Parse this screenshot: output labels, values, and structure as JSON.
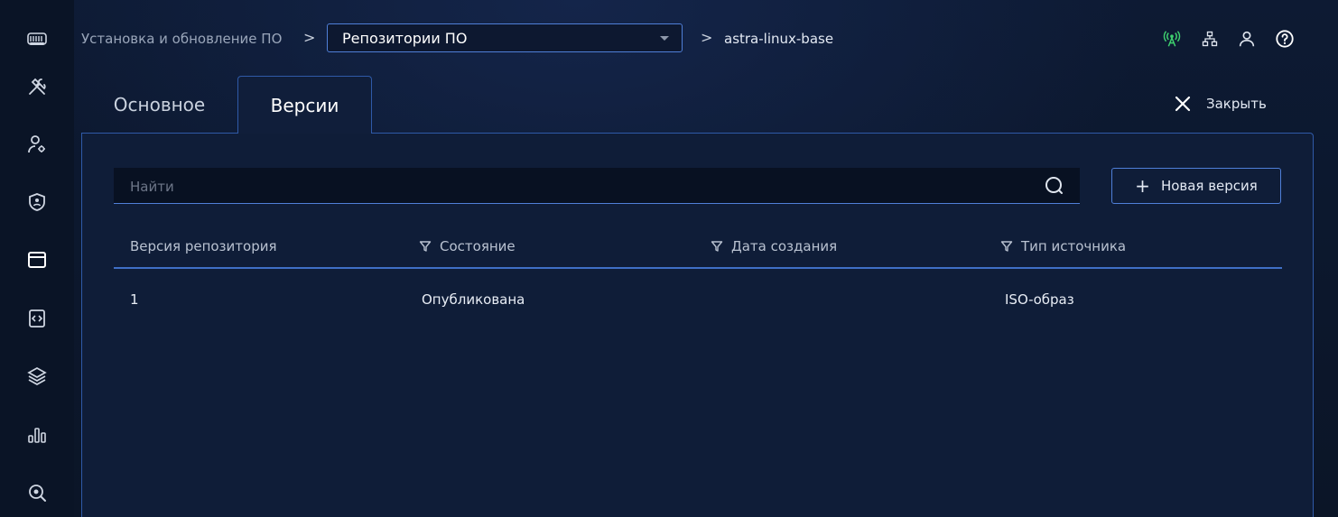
{
  "sidebar": {
    "items": [
      {
        "icon": "logo-icon"
      },
      {
        "icon": "tools-icon"
      },
      {
        "icon": "user-settings-icon"
      },
      {
        "icon": "shield-icon"
      },
      {
        "icon": "window-icon"
      },
      {
        "icon": "code-file-icon"
      },
      {
        "icon": "layers-icon"
      },
      {
        "icon": "bar-chart-icon"
      },
      {
        "icon": "search-analytics-icon"
      }
    ]
  },
  "header": {
    "breadcrumb_root": "Установка и обновление ПО",
    "breadcrumb_separator": ">",
    "section_select": "Репозитории ПО",
    "breadcrumb_current": "astra-linux-base",
    "icons": [
      "antenna-icon",
      "network-icon",
      "user-icon",
      "help-icon"
    ],
    "accent_status_color": "#3ecf6e"
  },
  "tabs": [
    {
      "label": "Основное",
      "active": false
    },
    {
      "label": "Версии",
      "active": true
    }
  ],
  "close_label": "Закрыть",
  "search": {
    "placeholder": "Найти",
    "value": ""
  },
  "new_version_label": "Новая версия",
  "table": {
    "columns": [
      {
        "label": "Версия репозитория",
        "filter": false
      },
      {
        "label": "Состояние",
        "filter": true
      },
      {
        "label": "Дата создания",
        "filter": true
      },
      {
        "label": "Тип источника",
        "filter": true
      }
    ],
    "rows": [
      {
        "version": "1",
        "state": "Опубликована",
        "created": "",
        "source_type": "ISO-образ"
      }
    ]
  },
  "colors": {
    "accent": "#4f7fd8",
    "background": "#0b1527",
    "panel": "#0f1d38"
  }
}
